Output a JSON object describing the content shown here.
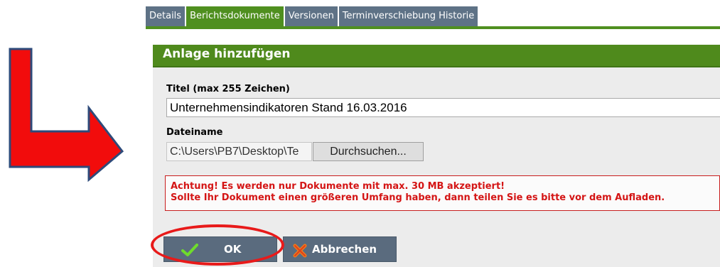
{
  "tabs": [
    {
      "label": "Details"
    },
    {
      "label": "Berichtsdokumente"
    },
    {
      "label": "Versionen"
    },
    {
      "label": "Terminverschiebung Historie"
    }
  ],
  "dialog": {
    "title": "Anlage hinzufügen",
    "title_field": {
      "label": "Titel (max 255 Zeichen)",
      "value": "Unternehmensindikatoren Stand 16.03.2016"
    },
    "file_field": {
      "label": "Dateiname",
      "value": "C:\\Users\\PB7\\Desktop\\Te",
      "browse_label": "Durchsuchen..."
    },
    "warning": {
      "line1": "Achtung! Es werden nur Dokumente mit max. 30 MB akzeptiert!",
      "line2": "Sollte Ihr Dokument einen größeren Umfang haben, dann teilen Sie es bitte vor dem Aufladen."
    },
    "buttons": {
      "ok_label": "OK",
      "cancel_label": "Abbrechen"
    }
  },
  "colors": {
    "active_tab": "#4f8f1f",
    "inactive_tab": "#5e7286",
    "header_green": "#4f8a1c",
    "warning_red": "#d41515",
    "annotation_red": "#e81a1a",
    "arrow_border": "#2e4a7a"
  },
  "icons": {
    "ok": "checkmark-icon",
    "cancel": "cross-icon",
    "annotation": "red-arrow-icon"
  }
}
